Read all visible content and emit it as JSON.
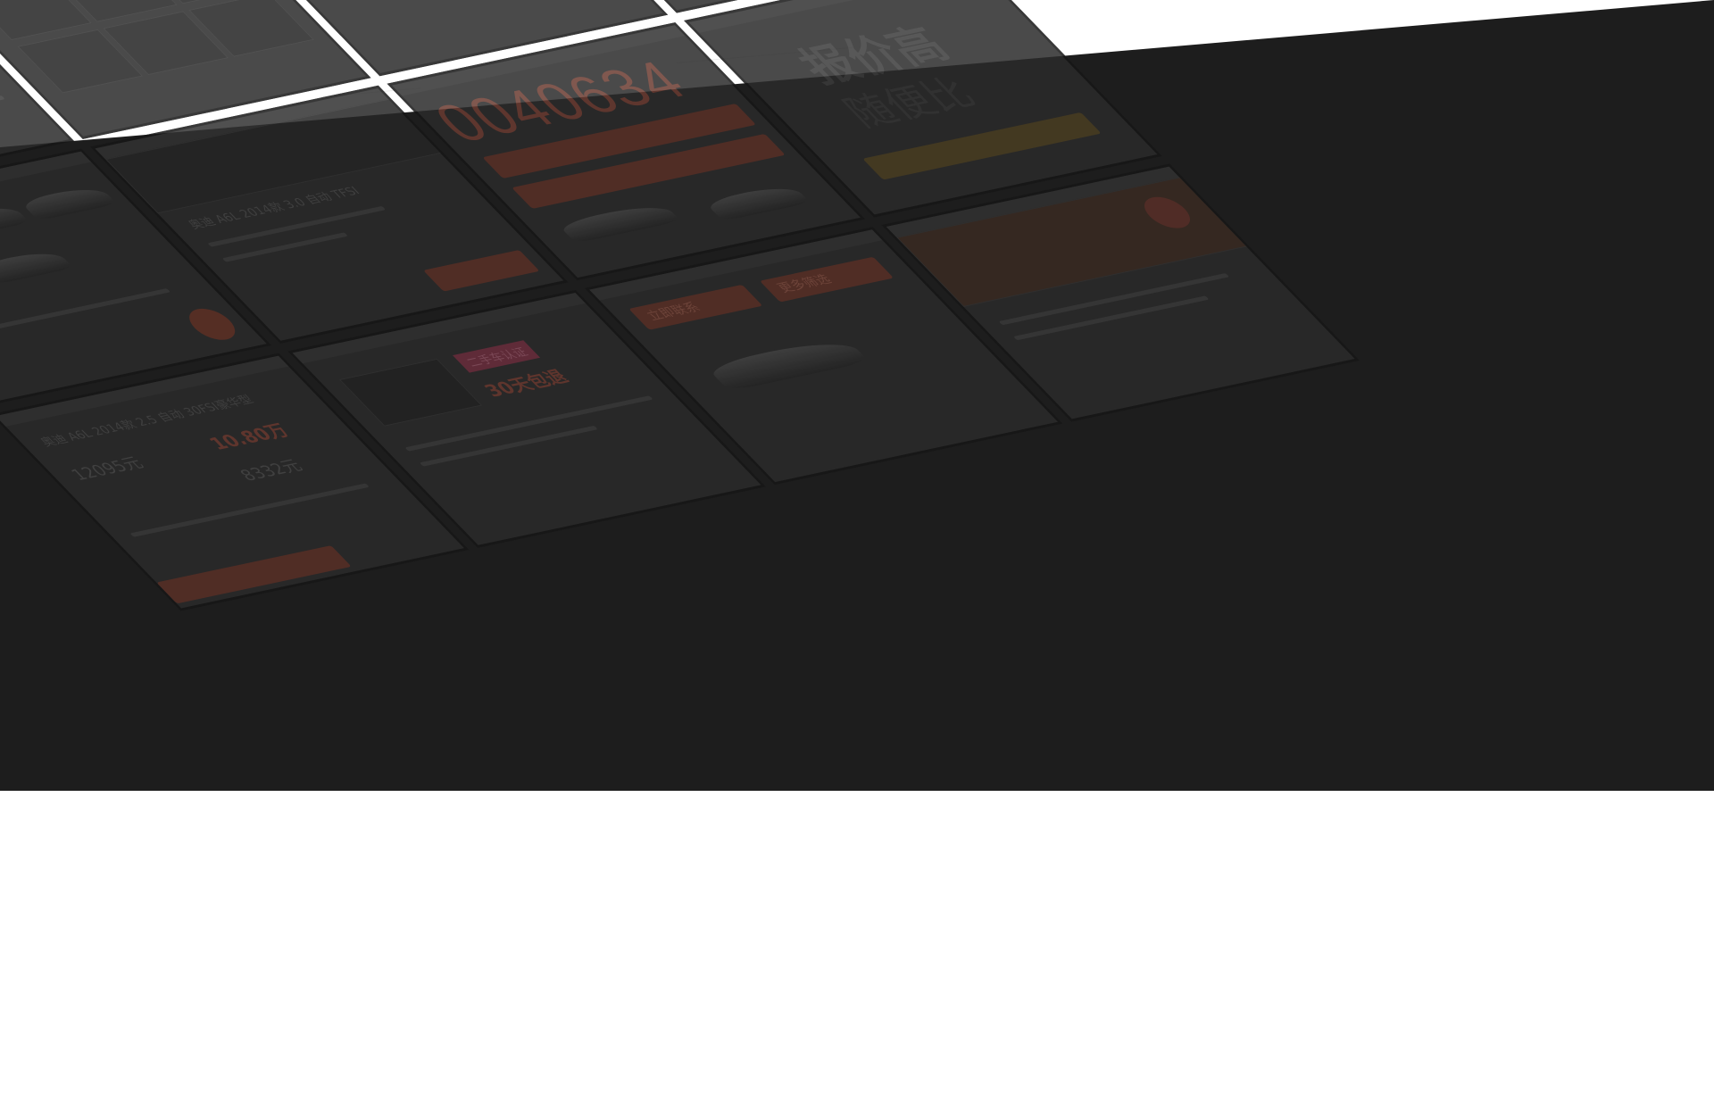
{
  "screens": {
    "detail_title": "奥迪 A6L 2014款 3.0 自动 TFSI",
    "hero_number": "0040634",
    "promo_headline": "报价高",
    "promo_subheadline": "随便比",
    "price_a_label": "12095元",
    "price_b_label": "10.80万",
    "price_c_label": "8332元",
    "listing_title": "奥迪 A6L 2014款 2.5 自动 30FSI豪华型",
    "cert_badge": "二手车认证",
    "cert_price": "30天包退",
    "nav_contact": "立即联系",
    "nav_subscribe": "更多筛选"
  },
  "colors": {
    "background": "#ffffff",
    "overlay": "#1d1d1d",
    "accent": "#e8503a"
  }
}
